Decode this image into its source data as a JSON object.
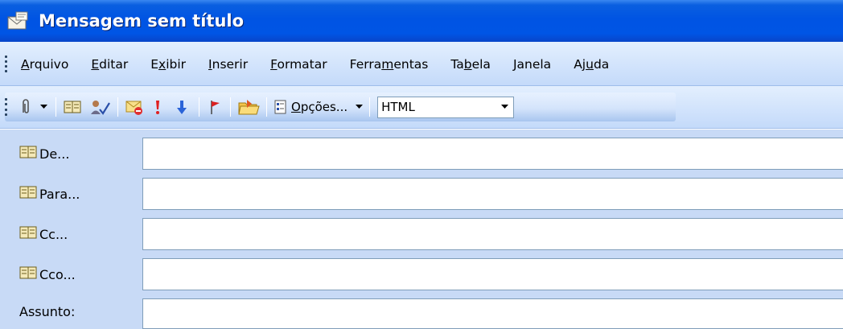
{
  "window": {
    "title": "Mensagem sem título",
    "icon": "message-envelope-icon"
  },
  "menu": {
    "items": [
      {
        "name": "arquivo",
        "pre": "",
        "ul": "A",
        "post": "rquivo"
      },
      {
        "name": "editar",
        "pre": "",
        "ul": "E",
        "post": "ditar"
      },
      {
        "name": "exibir",
        "pre": "E",
        "ul": "x",
        "post": "ibir"
      },
      {
        "name": "inserir",
        "pre": "",
        "ul": "I",
        "post": "nserir"
      },
      {
        "name": "formatar",
        "pre": "",
        "ul": "F",
        "post": "ormatar"
      },
      {
        "name": "ferramentas",
        "pre": "Ferra",
        "ul": "m",
        "post": "entas"
      },
      {
        "name": "tabela",
        "pre": "Ta",
        "ul": "b",
        "post": "ela"
      },
      {
        "name": "janela",
        "pre": "",
        "ul": "J",
        "post": "anela"
      },
      {
        "name": "ajuda",
        "pre": "Aj",
        "ul": "u",
        "post": "da"
      }
    ]
  },
  "toolbar": {
    "options_pre": "",
    "options_ul": "O",
    "options_post": "pções...",
    "format_value": "HTML",
    "icons": [
      "paperclip-icon",
      "address-book-icon",
      "check-names-icon",
      "permission-icon",
      "importance-high-icon",
      "importance-low-icon",
      "flag-icon",
      "open-folder-icon",
      "options-icon"
    ]
  },
  "fields": {
    "from_label": "De...",
    "to_label": "Para...",
    "cc_label": "Cc...",
    "bcc_label": "Cco...",
    "subject_label": "Assunto:",
    "from_value": "",
    "to_value": "",
    "cc_value": "",
    "bcc_value": "",
    "subject_value": ""
  },
  "colors": {
    "titlebar": "#0054e3",
    "menubar": "#c4dafa",
    "fields_bg": "#c8daf6",
    "input_border": "#7f9db9"
  }
}
